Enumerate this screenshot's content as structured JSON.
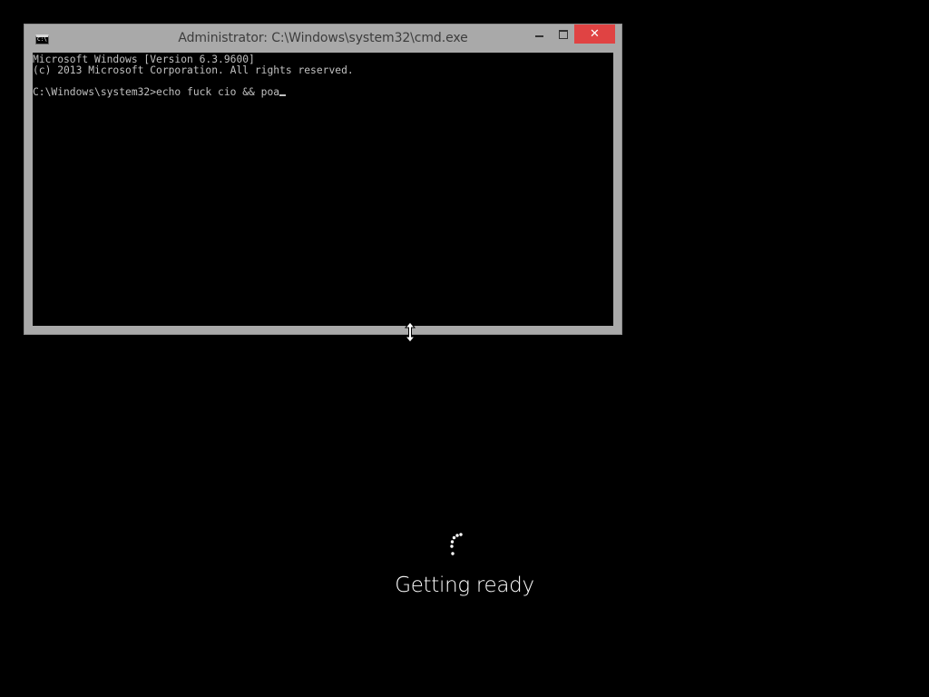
{
  "window": {
    "title": "Administrator: C:\\Windows\\system32\\cmd.exe",
    "icon_label": "C:\\",
    "icon": "cmd-icon",
    "buttons": {
      "minimize_icon": "minimize-icon",
      "maximize_icon": "maximize-icon",
      "close_label": "✕"
    },
    "close_color": "#e04343",
    "frame_color": "#a9a9a9"
  },
  "console": {
    "lines": [
      "Microsoft Windows [Version 6.3.9600]",
      "(c) 2013 Microsoft Corporation. All rights reserved.",
      "",
      "C:\\Windows\\system32>echo fuck cio && poa"
    ],
    "text_color": "#c0c0c0",
    "background": "#000000"
  },
  "cursor": {
    "icon": "vertical-resize-cursor-icon"
  },
  "status": {
    "spinner_icon": "loading-spinner-icon",
    "text": "Getting ready"
  }
}
